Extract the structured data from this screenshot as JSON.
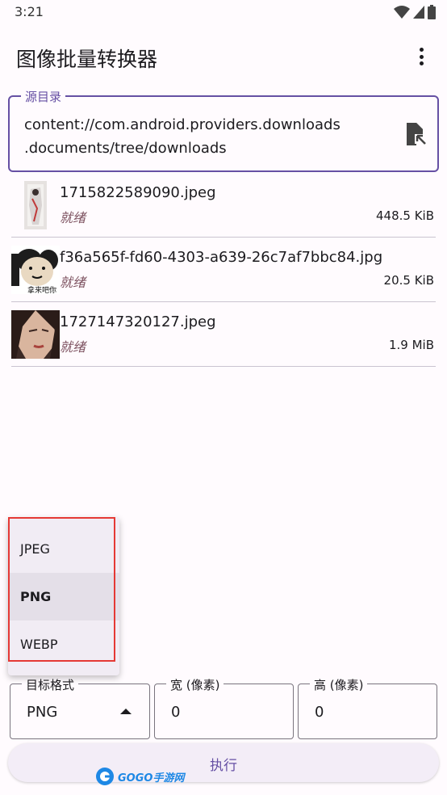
{
  "status": {
    "time": "3:21"
  },
  "app": {
    "title": "图像批量转换器"
  },
  "source": {
    "label": "源目录",
    "value_line1": "content://com.android.providers.downloads",
    "value_line2": ".documents/tree/downloads"
  },
  "files": [
    {
      "name": "1715822589090.jpeg",
      "status": "就绪",
      "size": "448.5 KiB"
    },
    {
      "name": "f36a565f-fd60-4303-a639-26c7af7bbc84.jpg",
      "status": "就绪",
      "size": "20.5 KiB",
      "thumb_caption": "拿来吧你"
    },
    {
      "name": "1727147320127.jpeg",
      "status": "就绪",
      "size": "1.9 MiB"
    }
  ],
  "format_menu": {
    "options": [
      "JPEG",
      "PNG",
      "WEBP"
    ],
    "selected": "PNG"
  },
  "output": {
    "format_label": "目标格式",
    "format_value": "PNG",
    "width_label": "宽 (像素)",
    "width_value": "0",
    "height_label": "高 (像素)",
    "height_value": "0"
  },
  "actions": {
    "execute_label": "执行"
  },
  "watermark": {
    "text": "GOGO手游网"
  },
  "colors": {
    "accent": "#6650a4",
    "status_text": "#7d5260",
    "highlight_border": "#e53935"
  }
}
